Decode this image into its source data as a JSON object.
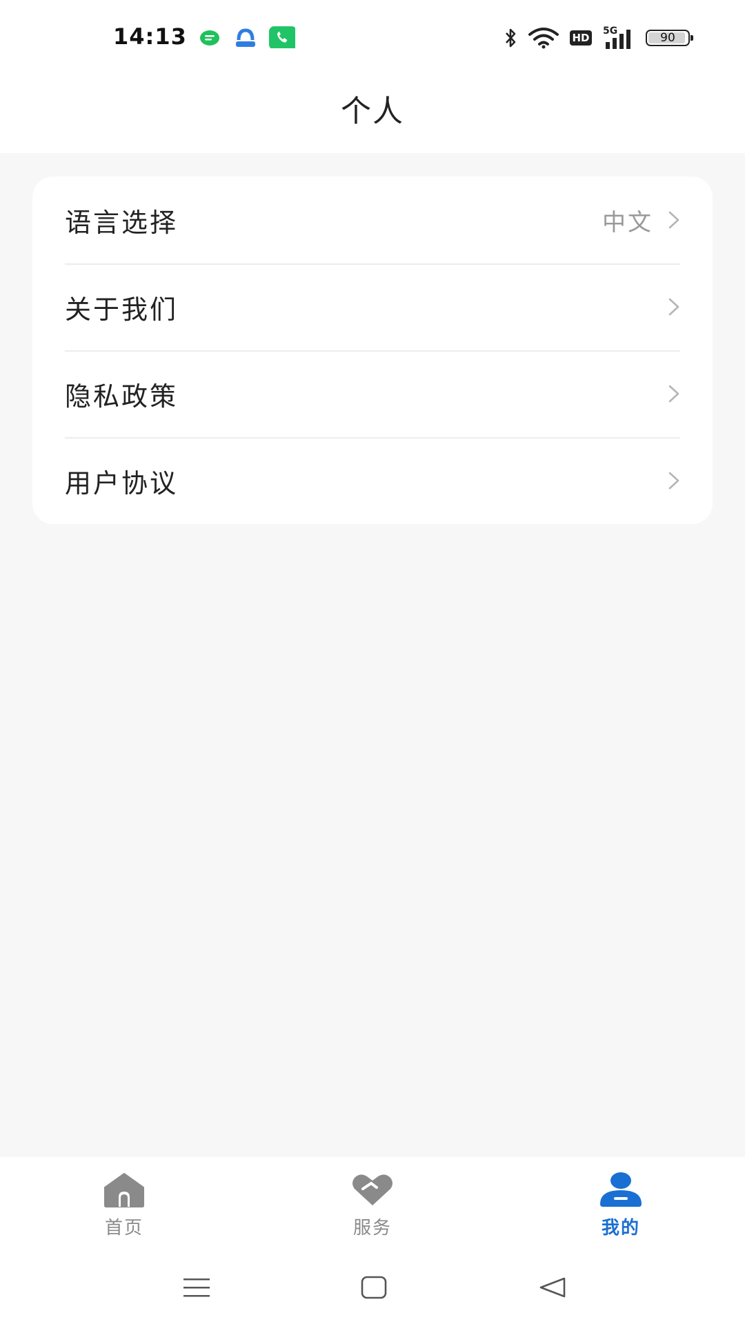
{
  "status_bar": {
    "time": "14:13",
    "battery": 90,
    "battery_label": "90",
    "hd_label": "HD",
    "network_label": "5G",
    "notification_icons": [
      "message-app-icon",
      "ai-assistant-icon",
      "phone-app-icon"
    ]
  },
  "header": {
    "title": "个人"
  },
  "settings": {
    "items": [
      {
        "label": "语言选择",
        "value": "中文"
      },
      {
        "label": "关于我们",
        "value": ""
      },
      {
        "label": "隐私政策",
        "value": ""
      },
      {
        "label": "用户协议",
        "value": ""
      }
    ]
  },
  "tabs": [
    {
      "label": "首页",
      "icon": "home-icon",
      "active": false
    },
    {
      "label": "服务",
      "icon": "heart-icon",
      "active": false
    },
    {
      "label": "我的",
      "icon": "user-icon",
      "active": true
    }
  ],
  "nav": {
    "buttons": [
      "menu-icon",
      "home-square-icon",
      "back-triangle-icon"
    ]
  },
  "colors": {
    "accent": "#1a6fd3",
    "inactive": "#8a8a8a",
    "background": "#f7f7f7",
    "card": "#ffffff"
  }
}
